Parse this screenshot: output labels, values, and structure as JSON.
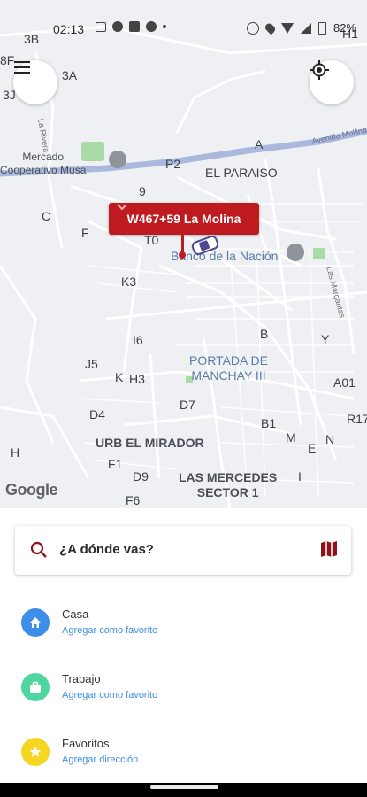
{
  "status_bar": {
    "time": "02:13",
    "battery": "82%"
  },
  "map": {
    "labels": {
      "l3b": "3B",
      "l8f": "8F",
      "l3j": "3J",
      "l3a": "3A",
      "h1": "H1",
      "a": "A",
      "mercado": "Mercado\nCooperativo Musa",
      "p2": "P2",
      "el_paraiso": "EL PARAISO",
      "l9": "9",
      "c": "C",
      "f": "F",
      "t0": "T0",
      "banco": "Banco de la Nación",
      "k3": "K3",
      "i6": "I6",
      "b": "B",
      "y": "Y",
      "j5": "J5",
      "k": "K",
      "h3": "H3",
      "portada": "PORTADA DE\nMANCHAY III",
      "a01": "A01",
      "d7": "D7",
      "d4": "D4",
      "r17": "R17",
      "b1": "B1",
      "urb": "URB EL MIRADOR",
      "m": "M",
      "n": "N",
      "e": "E",
      "h": "H",
      "f1": "F1",
      "d9": "D9",
      "i": "I",
      "mercedes": "LAS MERCEDES\nSECTOR 1",
      "f6": "F6",
      "avenida": "Avenida Mollina",
      "la_rivera": "La Rivera",
      "margaritas": "Las Margaritas",
      "google": "Google"
    },
    "pin_label": "W467+59 La Molina"
  },
  "sheet": {
    "search_placeholder": "¿A dónde vas?",
    "items": [
      {
        "title": "Casa",
        "subtitle": "Agregar como favorito",
        "color": "#3d8ee6",
        "icon": "home-icon"
      },
      {
        "title": "Trabajo",
        "subtitle": "Agregar como favorito",
        "color": "#4fd6a0",
        "icon": "briefcase-icon"
      },
      {
        "title": "Favoritos",
        "subtitle": "Agregar dirección",
        "color": "#f5d623",
        "icon": "star-icon"
      }
    ]
  },
  "colors": {
    "brand_red": "#bf1a1f",
    "link_blue": "#3d8ee6"
  }
}
